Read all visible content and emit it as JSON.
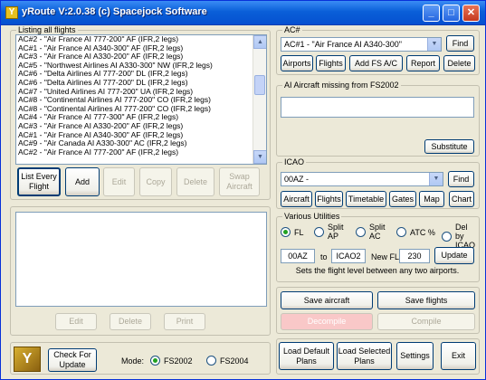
{
  "window": {
    "title": "yRoute V:2.0.38 (c) Spacejock Software"
  },
  "flights": {
    "legend": "Listing all flights",
    "items": [
      "AC#2 - \"Air France AI 777-200\" AF (IFR,2 legs)",
      "AC#1 - \"Air France AI A340-300\" AF (IFR,2 legs)",
      "AC#3 - \"Air France AI A330-200\" AF (IFR,2 legs)",
      "AC#5 - \"Northwest Airlines AI A330-300\" NW (IFR,2 legs)",
      "AC#6 - \"Delta Airlines AI 777-200\" DL (IFR,2 legs)",
      "AC#6 - \"Delta Airlines AI 777-200\" DL (IFR,2 legs)",
      "AC#7 - \"United Airlines AI 777-200\" UA (IFR,2 legs)",
      "AC#8 - \"Continental Airlines AI 777-200\" CO (IFR,2 legs)",
      "AC#8 - \"Continental Airlines AI 777-200\" CO (IFR,2 legs)",
      "AC#4 - \"Air France AI 777-300\" AF (IFR,2 legs)",
      "AC#3 - \"Air France AI A330-200\" AF (IFR,2 legs)",
      "AC#1 - \"Air France AI A340-300\" AF (IFR,2 legs)",
      "AC#9 - \"Air Canada AI A330-300\" AC (IFR,2 legs)",
      "AC#2 - \"Air France AI 777-200\" AF (IFR,2 legs)"
    ],
    "buttons": {
      "list": "List Every Flight",
      "add": "Add",
      "edit": "Edit",
      "copy": "Copy",
      "delete": "Delete",
      "swap": "Swap Aircraft"
    }
  },
  "legs": {
    "buttons": {
      "edit": "Edit",
      "delete": "Delete",
      "print": "Print"
    }
  },
  "bottom": {
    "check": "Check For Update",
    "mode_label": "Mode:",
    "mode_fs2002": "FS2002",
    "mode_fs2004": "FS2004"
  },
  "ac": {
    "legend": "AC#",
    "selected": "AC#1 - \"Air France AI A340-300\"",
    "find": "Find",
    "buttons": {
      "airports": "Airports",
      "flights": "Flights",
      "add_fs": "Add FS A/C",
      "report": "Report",
      "delete": "Delete"
    }
  },
  "missing": {
    "legend": "AI Aircraft missing from FS2002",
    "substitute": "Substitute"
  },
  "icao": {
    "legend": "ICAO",
    "selected": "00AZ -",
    "find": "Find",
    "buttons": {
      "aircraft": "Aircraft",
      "flights": "Flights",
      "timetable": "Timetable",
      "gates": "Gates",
      "map": "Map",
      "chart": "Chart"
    }
  },
  "utils": {
    "legend": "Various Utilities",
    "radios": {
      "fl": "FL",
      "split_ap": "Split AP",
      "split_ac": "Split AC",
      "atc": "ATC %",
      "del_icao": "Del by ICAO"
    },
    "from": "00AZ",
    "to_label": "to",
    "to": "ICAO2",
    "newfl_label": "New FL:",
    "newfl": "230",
    "update": "Update",
    "hint": "Sets the flight level between any two airports."
  },
  "save": {
    "aircraft": "Save aircraft",
    "flights": "Save flights",
    "decompile": "Decompile",
    "compile": "Compile"
  },
  "footer": {
    "load_default": "Load Default Plans",
    "load_selected": "Load Selected Plans",
    "settings": "Settings",
    "exit": "Exit"
  }
}
